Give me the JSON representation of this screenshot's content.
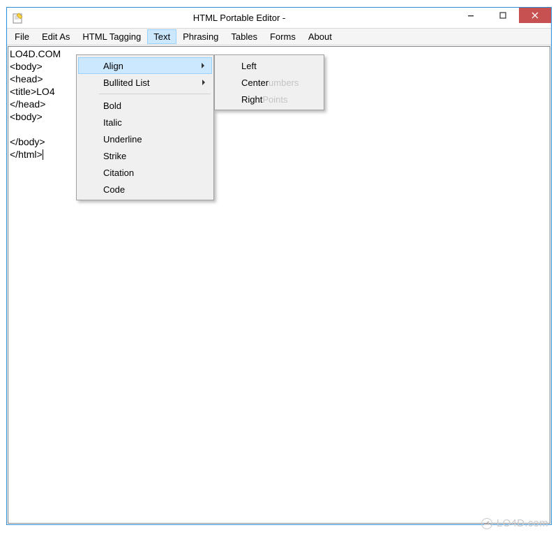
{
  "titlebar": {
    "title": "HTML Portable Editor -"
  },
  "menubar": {
    "items": [
      {
        "label": "File"
      },
      {
        "label": "Edit As"
      },
      {
        "label": "HTML Tagging"
      },
      {
        "label": "Text"
      },
      {
        "label": "Phrasing"
      },
      {
        "label": "Tables"
      },
      {
        "label": "Forms"
      },
      {
        "label": "About"
      }
    ]
  },
  "editor": {
    "content": "LO4D.COM\n<body>\n<head>\n<title>LO4\n</head>\n<body>\n\n</body>\n</html>"
  },
  "text_menu": {
    "items_top": [
      {
        "label": "Align",
        "has_sub": true,
        "hover": true
      },
      {
        "label": "Bullited List",
        "has_sub": true
      }
    ],
    "items_bottom": [
      {
        "label": "Bold"
      },
      {
        "label": "Italic"
      },
      {
        "label": "Underline"
      },
      {
        "label": "Strike"
      },
      {
        "label": "Citation"
      },
      {
        "label": "Code"
      }
    ]
  },
  "align_submenu": {
    "items": [
      {
        "label": "Left",
        "ghost": ""
      },
      {
        "label": "Center",
        "ghost": "umbers"
      },
      {
        "label": "Right",
        "ghost": "Points"
      }
    ]
  },
  "watermark": {
    "text": "LO4D.com"
  }
}
